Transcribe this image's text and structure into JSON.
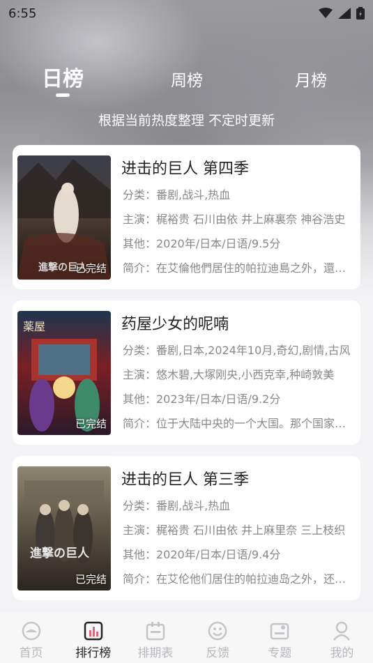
{
  "status_bar": {
    "time": "6:55"
  },
  "rank_tabs": [
    {
      "label": "日榜"
    },
    {
      "label": "周榜"
    },
    {
      "label": "月榜"
    }
  ],
  "subtitle": "根据当前热度整理 不定时更新",
  "cards": [
    {
      "title": "进击的巨人 第四季",
      "category": "分类：番剧,战斗,热血",
      "cast": "主演：梶裕贵 石川由依 井上麻裏奈 神谷浩史",
      "other": "其他：2020年/日本/日语/9.5分",
      "intro": "简介：在艾倫他們居住的帕拉迪島之外，還有其他國家",
      "badge": "已完结"
    },
    {
      "title": "药屋少女的呢喃",
      "category": "分类：番剧,日本,2024年10月,奇幻,剧情,古风",
      "cast": "主演：悠木碧,大塚刚央,小西克幸,种崎敦美",
      "other": "其他：2023年/日本/日语/9.2分",
      "intro": "简介：位于大陆中央的一个大国。那个国家的皇帝",
      "badge": "已完结"
    },
    {
      "title": "进击的巨人 第三季",
      "category": "分类：番剧,战斗,热血",
      "cast": "主演：梶裕贵 石川由依 井上麻里奈 三上枝织",
      "other": "其他：2020年/日本/日语/9.4分",
      "intro": "简介：在艾伦他们居住的帕拉迪岛之外，还有其他国家",
      "badge": "已完结"
    }
  ],
  "bottom_nav": [
    {
      "label": "首页",
      "icon": "home-icon"
    },
    {
      "label": "排行榜",
      "icon": "ranking-icon"
    },
    {
      "label": "排期表",
      "icon": "calendar-icon"
    },
    {
      "label": "反馈",
      "icon": "feedback-icon"
    },
    {
      "label": "专题",
      "icon": "topic-icon"
    },
    {
      "label": "我的",
      "icon": "profile-icon"
    }
  ],
  "colors": {
    "accent": "#e8637a",
    "card_bg": "#ffffff",
    "page_bg": "#f3f3f5",
    "muted_text": "#888888"
  }
}
